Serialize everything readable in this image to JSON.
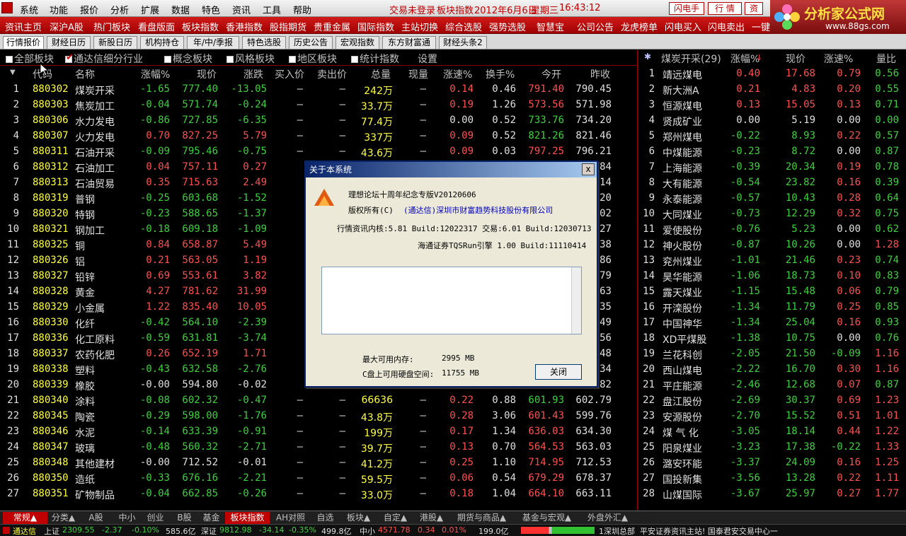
{
  "menubar": {
    "items": [
      "系统",
      "功能",
      "报价",
      "分析",
      "扩展",
      "数据",
      "特色",
      "资讯",
      "工具",
      "帮助"
    ],
    "status": "交易未登录",
    "title": "板块指数",
    "date": "2012年6月6日",
    "weekday": "星期三",
    "time": "16:43:12",
    "btn_flash": "闪电手",
    "btn_quote": "行 情",
    "btn_info": "资"
  },
  "logo": {
    "text": "分析家公式网",
    "url": "www.88gs.com"
  },
  "toolbar": {
    "items": [
      "资讯主页",
      "深沪A股",
      "热门板块",
      "看盘版面",
      "板块指数",
      "香港指数",
      "股指期货",
      "贵重金属",
      "国际指数",
      "主站切换",
      "综合选股",
      "强势选股",
      "智慧宝",
      "公司公告",
      "龙虎榜单",
      "闪电买入",
      "闪电卖出",
      "一键"
    ]
  },
  "tabs": [
    "行情报价",
    "财经日历",
    "新股日历",
    "机构持仓",
    "年/中/季报",
    "特色选股",
    "历史公告",
    "宏观指数",
    "东方财富通",
    "财经头条2"
  ],
  "filters": {
    "items": [
      "全部板块",
      "通达信细分行业",
      "概念板块",
      "风格板块",
      "地区板块",
      "统计指数"
    ],
    "settings": "设置"
  },
  "table": {
    "headers": [
      "代码",
      "名称",
      "涨幅%",
      "现价",
      "涨跌",
      "买入价",
      "卖出价",
      "总量",
      "现量",
      "涨速%",
      "换手%",
      "今开",
      "昨收"
    ],
    "rows": [
      {
        "i": "1",
        "code": "880302",
        "name": "煤炭开采",
        "pct": "-1.65",
        "price": "777.40",
        "chg": "-13.05",
        "buy": "—",
        "sell": "—",
        "vol": "242万",
        "cur": "—",
        "spd": "0.14",
        "turn": "0.46",
        "open": "791.40",
        "prev": "790.45"
      },
      {
        "i": "2",
        "code": "880303",
        "name": "焦炭加工",
        "pct": "-0.04",
        "price": "571.74",
        "chg": "-0.24",
        "buy": "—",
        "sell": "—",
        "vol": "33.7万",
        "cur": "—",
        "spd": "0.19",
        "turn": "1.26",
        "open": "573.56",
        "prev": "571.98"
      },
      {
        "i": "3",
        "code": "880306",
        "name": "水力发电",
        "pct": "-0.86",
        "price": "727.85",
        "chg": "-6.35",
        "buy": "—",
        "sell": "—",
        "vol": "77.4万",
        "cur": "—",
        "spd": "0.00",
        "turn": "0.52",
        "open": "733.76",
        "prev": "734.20"
      },
      {
        "i": "4",
        "code": "880307",
        "name": "火力发电",
        "pct": "0.70",
        "price": "827.25",
        "chg": "5.79",
        "buy": "—",
        "sell": "—",
        "vol": "337万",
        "cur": "—",
        "spd": "0.09",
        "turn": "0.52",
        "open": "821.26",
        "prev": "821.46"
      },
      {
        "i": "5",
        "code": "880311",
        "name": "石油开采",
        "pct": "-0.09",
        "price": "795.46",
        "chg": "-0.75",
        "buy": "—",
        "sell": "—",
        "vol": "43.6万",
        "cur": "—",
        "spd": "0.09",
        "turn": "0.03",
        "open": "797.25",
        "prev": "796.21"
      },
      {
        "i": "6",
        "code": "880312",
        "name": "石油加工",
        "pct": "0.04",
        "price": "757.11",
        "chg": "0.27",
        "buy": "",
        "sell": "",
        "vol": "",
        "cur": "",
        "spd": "",
        "turn": "",
        "open": "",
        "prev": ".84"
      },
      {
        "i": "7",
        "code": "880313",
        "name": "石油贸易",
        "pct": "0.35",
        "price": "715.63",
        "chg": "2.49",
        "buy": "",
        "sell": "",
        "vol": "",
        "cur": "",
        "spd": "",
        "turn": "",
        "open": "",
        "prev": ".14"
      },
      {
        "i": "8",
        "code": "880319",
        "name": "普钢",
        "pct": "-0.25",
        "price": "603.68",
        "chg": "-1.52",
        "buy": "",
        "sell": "",
        "vol": "",
        "cur": "",
        "spd": "",
        "turn": "",
        "open": "",
        "prev": ".20"
      },
      {
        "i": "9",
        "code": "880320",
        "name": "特钢",
        "pct": "-0.23",
        "price": "588.65",
        "chg": "-1.37",
        "buy": "",
        "sell": "",
        "vol": "",
        "cur": "",
        "spd": "",
        "turn": "",
        "open": "",
        "prev": ".02"
      },
      {
        "i": "10",
        "code": "880321",
        "name": "钢加工",
        "pct": "-0.18",
        "price": "609.18",
        "chg": "-1.09",
        "buy": "",
        "sell": "",
        "vol": "",
        "cur": "",
        "spd": "",
        "turn": "",
        "open": "",
        "prev": ".27"
      },
      {
        "i": "11",
        "code": "880325",
        "name": "铜",
        "pct": "0.84",
        "price": "658.87",
        "chg": "5.49",
        "buy": "",
        "sell": "",
        "vol": "",
        "cur": "",
        "spd": "",
        "turn": "",
        "open": "",
        "prev": ".38"
      },
      {
        "i": "12",
        "code": "880326",
        "name": "铝",
        "pct": "0.21",
        "price": "563.05",
        "chg": "1.19",
        "buy": "",
        "sell": "",
        "vol": "",
        "cur": "",
        "spd": "",
        "turn": "",
        "open": "",
        "prev": ".86"
      },
      {
        "i": "13",
        "code": "880327",
        "name": "铅锌",
        "pct": "0.69",
        "price": "553.61",
        "chg": "3.82",
        "buy": "",
        "sell": "",
        "vol": "",
        "cur": "",
        "spd": "",
        "turn": "",
        "open": "",
        "prev": ".79"
      },
      {
        "i": "14",
        "code": "880328",
        "name": "黄金",
        "pct": "4.27",
        "price": "781.62",
        "chg": "31.99",
        "buy": "",
        "sell": "",
        "vol": "",
        "cur": "",
        "spd": "",
        "turn": "",
        "open": "",
        "prev": ".63"
      },
      {
        "i": "15",
        "code": "880329",
        "name": "小金属",
        "pct": "1.22",
        "price": "835.40",
        "chg": "10.05",
        "buy": "",
        "sell": "",
        "vol": "",
        "cur": "",
        "spd": "",
        "turn": "",
        "open": "",
        "prev": ".35"
      },
      {
        "i": "16",
        "code": "880330",
        "name": "化纤",
        "pct": "-0.42",
        "price": "564.10",
        "chg": "-2.39",
        "buy": "",
        "sell": "",
        "vol": "",
        "cur": "",
        "spd": "",
        "turn": "",
        "open": "",
        "prev": ".49"
      },
      {
        "i": "17",
        "code": "880336",
        "name": "化工原料",
        "pct": "-0.59",
        "price": "631.81",
        "chg": "-3.74",
        "buy": "",
        "sell": "",
        "vol": "",
        "cur": "",
        "spd": "",
        "turn": "",
        "open": "",
        "prev": ".56"
      },
      {
        "i": "18",
        "code": "880337",
        "name": "农药化肥",
        "pct": "0.26",
        "price": "652.19",
        "chg": "1.71",
        "buy": "",
        "sell": "",
        "vol": "",
        "cur": "",
        "spd": "",
        "turn": "",
        "open": "",
        "prev": ".48"
      },
      {
        "i": "19",
        "code": "880338",
        "name": "塑料",
        "pct": "-0.43",
        "price": "632.58",
        "chg": "-2.76",
        "buy": "",
        "sell": "",
        "vol": "",
        "cur": "",
        "spd": "",
        "turn": "",
        "open": "",
        "prev": ".34"
      },
      {
        "i": "20",
        "code": "880339",
        "name": "橡胶",
        "pct": "-0.00",
        "price": "594.80",
        "chg": "-0.02",
        "buy": "",
        "sell": "",
        "vol": "",
        "cur": "",
        "spd": "",
        "turn": "",
        "open": "",
        "prev": ".82"
      },
      {
        "i": "21",
        "code": "880340",
        "name": "涂料",
        "pct": "-0.08",
        "price": "602.32",
        "chg": "-0.47",
        "buy": "—",
        "sell": "—",
        "vol": "66636",
        "cur": "—",
        "spd": "0.22",
        "turn": "0.88",
        "open": "601.93",
        "prev": "602.79"
      },
      {
        "i": "22",
        "code": "880345",
        "name": "陶瓷",
        "pct": "-0.29",
        "price": "598.00",
        "chg": "-1.76",
        "buy": "—",
        "sell": "—",
        "vol": "43.8万",
        "cur": "—",
        "spd": "0.28",
        "turn": "3.06",
        "open": "601.43",
        "prev": "599.76"
      },
      {
        "i": "23",
        "code": "880346",
        "name": "水泥",
        "pct": "-0.14",
        "price": "633.39",
        "chg": "-0.91",
        "buy": "—",
        "sell": "—",
        "vol": "199万",
        "cur": "—",
        "spd": "0.17",
        "turn": "1.34",
        "open": "636.03",
        "prev": "634.30"
      },
      {
        "i": "24",
        "code": "880347",
        "name": "玻璃",
        "pct": "-0.48",
        "price": "560.32",
        "chg": "-2.71",
        "buy": "—",
        "sell": "—",
        "vol": "39.7万",
        "cur": "—",
        "spd": "0.13",
        "turn": "0.70",
        "open": "564.53",
        "prev": "563.03"
      },
      {
        "i": "25",
        "code": "880348",
        "name": "其他建材",
        "pct": "-0.00",
        "price": "712.52",
        "chg": "-0.01",
        "buy": "—",
        "sell": "—",
        "vol": "41.2万",
        "cur": "—",
        "spd": "0.25",
        "turn": "1.10",
        "open": "714.95",
        "prev": "712.53"
      },
      {
        "i": "26",
        "code": "880350",
        "name": "造纸",
        "pct": "-0.33",
        "price": "676.16",
        "chg": "-2.21",
        "buy": "—",
        "sell": "—",
        "vol": "59.5万",
        "cur": "—",
        "spd": "0.06",
        "turn": "0.54",
        "open": "679.29",
        "prev": "678.37"
      },
      {
        "i": "27",
        "code": "880351",
        "name": "矿物制品",
        "pct": "-0.04",
        "price": "662.85",
        "chg": "-0.26",
        "buy": "—",
        "sell": "—",
        "vol": "33.0万",
        "cur": "—",
        "spd": "0.18",
        "turn": "1.04",
        "open": "664.10",
        "prev": "663.11"
      }
    ]
  },
  "right_panel": {
    "title": "煤炭开采(29)",
    "headers": [
      "涨幅%",
      "现价",
      "涨速%",
      "量比"
    ],
    "rows": [
      {
        "i": "1",
        "name": "靖远煤电",
        "pct": "0.40",
        "price": "17.68",
        "spd": "0.79",
        "ratio": "0.56"
      },
      {
        "i": "2",
        "name": "新大洲A",
        "pct": "0.21",
        "price": "4.83",
        "spd": "0.20",
        "ratio": "0.55"
      },
      {
        "i": "3",
        "name": "恒源煤电",
        "pct": "0.13",
        "price": "15.05",
        "spd": "0.13",
        "ratio": "0.71"
      },
      {
        "i": "4",
        "name": "贤成矿业",
        "pct": "0.00",
        "price": "5.19",
        "spd": "0.00",
        "ratio": "0.00"
      },
      {
        "i": "5",
        "name": "郑州煤电",
        "pct": "-0.22",
        "price": "8.93",
        "spd": "0.22",
        "ratio": "0.57"
      },
      {
        "i": "6",
        "name": "中煤能源",
        "pct": "-0.23",
        "price": "8.72",
        "spd": "0.00",
        "ratio": "0.87"
      },
      {
        "i": "7",
        "name": "上海能源",
        "pct": "-0.39",
        "price": "20.34",
        "spd": "0.19",
        "ratio": "0.78"
      },
      {
        "i": "8",
        "name": "大有能源",
        "pct": "-0.54",
        "price": "23.82",
        "spd": "0.16",
        "ratio": "0.39"
      },
      {
        "i": "9",
        "name": "永泰能源",
        "pct": "-0.57",
        "price": "10.43",
        "spd": "0.28",
        "ratio": "0.64"
      },
      {
        "i": "10",
        "name": "大同煤业",
        "pct": "-0.73",
        "price": "12.29",
        "spd": "0.32",
        "ratio": "0.75"
      },
      {
        "i": "11",
        "name": "爱使股份",
        "pct": "-0.76",
        "price": "5.23",
        "spd": "0.00",
        "ratio": "0.62"
      },
      {
        "i": "12",
        "name": "神火股份",
        "pct": "-0.87",
        "price": "10.26",
        "spd": "0.00",
        "ratio": "1.28"
      },
      {
        "i": "13",
        "name": "兖州煤业",
        "pct": "-1.01",
        "price": "21.46",
        "spd": "0.23",
        "ratio": "0.74"
      },
      {
        "i": "14",
        "name": "昊华能源",
        "pct": "-1.06",
        "price": "18.73",
        "spd": "0.10",
        "ratio": "0.83"
      },
      {
        "i": "15",
        "name": "露天煤业",
        "pct": "-1.15",
        "price": "15.48",
        "spd": "0.06",
        "ratio": "0.79"
      },
      {
        "i": "16",
        "name": "开滦股份",
        "pct": "-1.34",
        "price": "11.79",
        "spd": "0.25",
        "ratio": "0.85"
      },
      {
        "i": "17",
        "name": "中国神华",
        "pct": "-1.34",
        "price": "25.04",
        "spd": "0.16",
        "ratio": "0.93"
      },
      {
        "i": "18",
        "name": "XD平煤股",
        "pct": "-1.38",
        "price": "10.75",
        "spd": "0.00",
        "ratio": "0.76"
      },
      {
        "i": "19",
        "name": "兰花科创",
        "pct": "-2.05",
        "price": "21.50",
        "spd": "-0.09",
        "ratio": "1.16"
      },
      {
        "i": "20",
        "name": "西山煤电",
        "pct": "-2.22",
        "price": "16.70",
        "spd": "0.30",
        "ratio": "1.16"
      },
      {
        "i": "21",
        "name": "平庄能源",
        "pct": "-2.46",
        "price": "12.68",
        "spd": "0.07",
        "ratio": "0.87"
      },
      {
        "i": "22",
        "name": "盘江股份",
        "pct": "-2.69",
        "price": "30.37",
        "spd": "0.69",
        "ratio": "1.23"
      },
      {
        "i": "23",
        "name": "安源股份",
        "pct": "-2.70",
        "price": "15.52",
        "spd": "0.51",
        "ratio": "1.01"
      },
      {
        "i": "24",
        "name": "煤 气 化",
        "pct": "-3.05",
        "price": "18.14",
        "spd": "0.44",
        "ratio": "1.22"
      },
      {
        "i": "25",
        "name": "阳泉煤业",
        "pct": "-3.23",
        "price": "17.38",
        "spd": "-0.22",
        "ratio": "1.33"
      },
      {
        "i": "26",
        "name": "潞安环能",
        "pct": "-3.37",
        "price": "24.09",
        "spd": "0.16",
        "ratio": "1.25"
      },
      {
        "i": "27",
        "name": "国投新集",
        "pct": "-3.56",
        "price": "13.28",
        "spd": "0.22",
        "ratio": "1.11"
      },
      {
        "i": "28",
        "name": "山煤国际",
        "pct": "-3.67",
        "price": "25.97",
        "spd": "0.27",
        "ratio": "1.77"
      }
    ]
  },
  "dialog": {
    "title": "关于本系统",
    "close_x": "x",
    "product": "理想论坛十周年纪念专版V20120606",
    "copyright_label": "版权所有(C)",
    "copyright_owner": "(通达信)深圳市财富趋势科技股份有限公司",
    "kernel_line": "行情资讯内核:5.81 Build:12022317 交易:6.01 Build:12030713",
    "engine_line": "海通证券TQSRun引擎 1.00 Build:11110414",
    "mem_label": "最大可用内存:",
    "mem_value": "2995 MB",
    "disk_label": "C盘上可用硬盘空间:",
    "disk_value": "11755 MB",
    "close_button": "关闭"
  },
  "bottom_tabs": [
    "常规▲",
    "分类▲",
    "A股",
    "中小",
    "创业",
    "B股",
    "基金",
    "板块指数",
    "AH对照",
    "自选",
    "板块▲",
    "自定▲",
    "港股▲",
    "期货与商品▲",
    "基金与宏观▲",
    "外盘外汇▲"
  ],
  "statusbar": {
    "brand": "通达信",
    "sh_label": "上证",
    "sh_value": "2309.55",
    "sh_chg": "-2.37",
    "sh_pct": "-0.10%",
    "sh_amt": "585.6亿",
    "sz_label": "深证",
    "sz_value": "9812.98",
    "sz_chg": "-34.14",
    "sz_pct": "-0.35%",
    "sz_amt": "499.8亿",
    "zx_label": "中小",
    "zx_value": "4571.78",
    "zx_chg": "0.34",
    "zx_pct": "0.01%",
    "zx_amt": "199.0亿",
    "server": "1深圳总部",
    "ticker": "平安证券资讯主站! 国泰君安交易中心一"
  }
}
